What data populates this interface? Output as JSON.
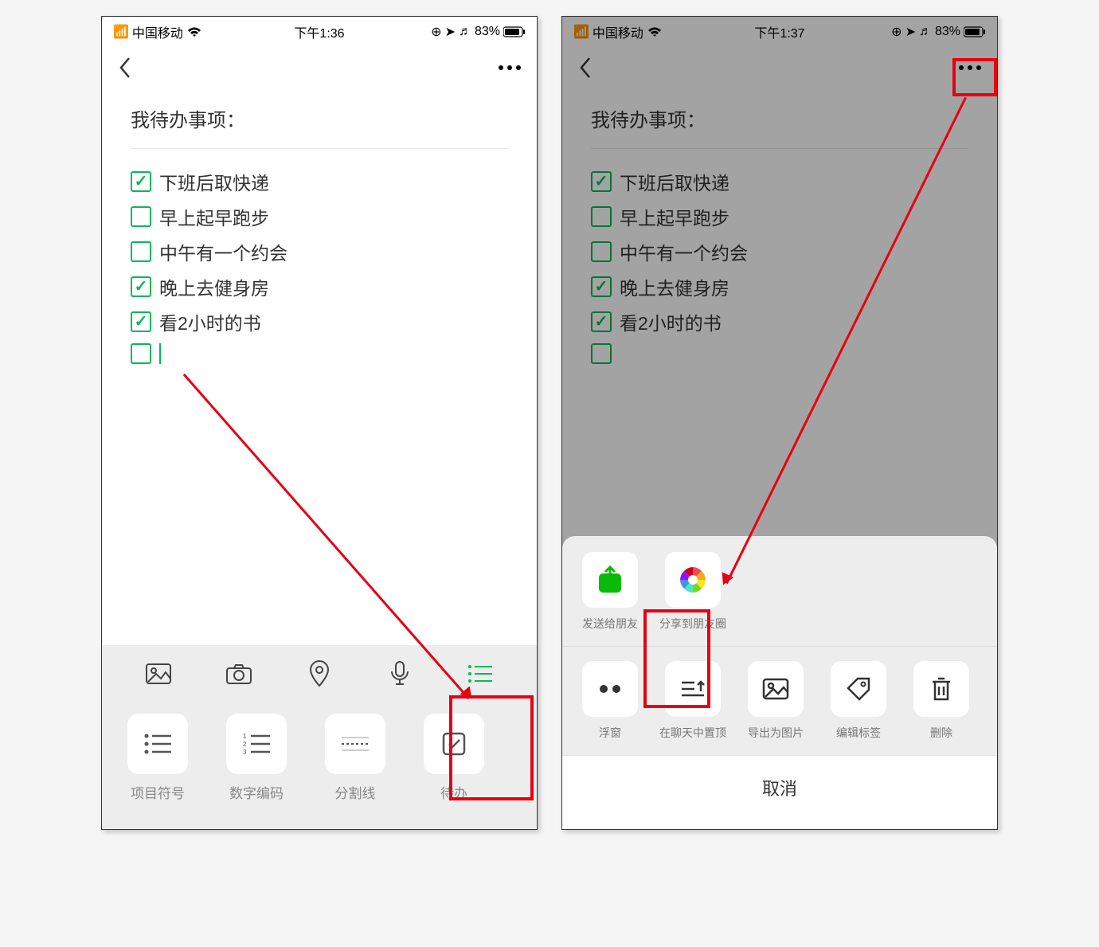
{
  "left": {
    "status": {
      "carrier": "中国移动",
      "time": "下午1:36",
      "battery": "83%"
    },
    "title": "我待办事项：",
    "todos": [
      {
        "text": "下班后取快递",
        "checked": true
      },
      {
        "text": "早上起早跑步",
        "checked": false
      },
      {
        "text": "中午有一个约会",
        "checked": false
      },
      {
        "text": "晚上去健身房",
        "checked": true
      },
      {
        "text": "看2小时的书",
        "checked": true
      },
      {
        "text": "",
        "checked": false
      }
    ],
    "toolbar_tabs": [
      {
        "name": "image-icon"
      },
      {
        "name": "camera-icon"
      },
      {
        "name": "location-icon"
      },
      {
        "name": "voice-icon"
      },
      {
        "name": "list-icon",
        "active": true
      }
    ],
    "toolbar_options": [
      {
        "label": "项目符号",
        "icon": "bullets"
      },
      {
        "label": "数字编码",
        "icon": "numbers"
      },
      {
        "label": "分割线",
        "icon": "divider"
      },
      {
        "label": "待办",
        "icon": "todo"
      }
    ]
  },
  "right": {
    "status": {
      "carrier": "中国移动",
      "time": "下午1:37",
      "battery": "83%"
    },
    "title": "我待办事项：",
    "todos": [
      {
        "text": "下班后取快递",
        "checked": true
      },
      {
        "text": "早上起早跑步",
        "checked": false
      },
      {
        "text": "中午有一个约会",
        "checked": false
      },
      {
        "text": "晚上去健身房",
        "checked": true
      },
      {
        "text": "看2小时的书",
        "checked": true
      },
      {
        "text": "",
        "checked": false
      }
    ],
    "share_row": [
      {
        "label": "发送给朋友",
        "icon": "send"
      },
      {
        "label": "分享到朋友圈",
        "icon": "moments"
      }
    ],
    "action_row": [
      {
        "label": "浮窗",
        "icon": "float"
      },
      {
        "label": "在聊天中置顶",
        "icon": "pin"
      },
      {
        "label": "导出为图片",
        "icon": "export"
      },
      {
        "label": "编辑标签",
        "icon": "tag"
      },
      {
        "label": "删除",
        "icon": "delete"
      }
    ],
    "cancel": "取消"
  }
}
